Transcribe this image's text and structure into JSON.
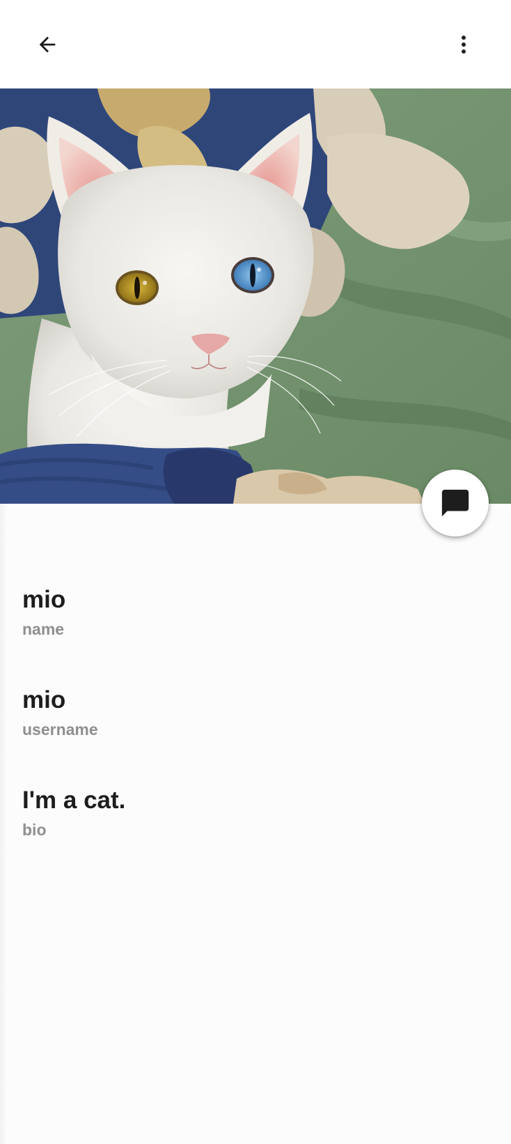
{
  "app_bar": {
    "back_icon": "arrow-back-icon",
    "menu_icon": "more-vert-icon"
  },
  "hero": {
    "image": "white odd-eyed cat profile photo"
  },
  "fab": {
    "icon": "chat-bubble-icon"
  },
  "profile": {
    "fields": [
      {
        "value": "mio",
        "label": "name"
      },
      {
        "value": "mio",
        "label": "username"
      },
      {
        "value": "I'm a cat.",
        "label": "bio"
      }
    ]
  },
  "colors": {
    "value_text": "#1d1d1d",
    "label_text": "#8f8f8f",
    "background": "#fdfcfc"
  }
}
